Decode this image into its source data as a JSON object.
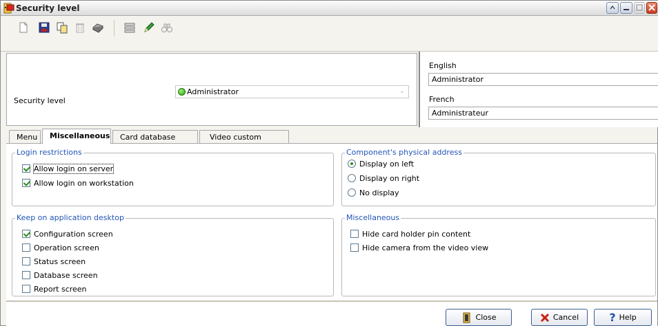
{
  "window": {
    "title": "Security level",
    "colors": {
      "title_gradient_top": "#fbfbfb",
      "close_button": "#c8381b",
      "accent_text": "#2155b5"
    }
  },
  "toolbar": {
    "icons": [
      "new-icon",
      "save-icon",
      "copy-icon",
      "delete-icon",
      "print-icon",
      "list-icon",
      "edit-pen-icon",
      "binoculars-icon"
    ]
  },
  "header": {
    "security_level_label": "Security level",
    "security_level_value": "Administrator",
    "status_color": "#2d9b10",
    "languages": [
      {
        "label": "English",
        "value": "Administrator"
      },
      {
        "label": "French",
        "value": "Administrateur"
      }
    ]
  },
  "tabs": [
    {
      "label": "Menu",
      "active": false
    },
    {
      "label": "Miscellaneous",
      "active": true
    },
    {
      "label": "Card database fields",
      "active": false
    },
    {
      "label": "Video custom button",
      "active": false
    }
  ],
  "groups": {
    "login": {
      "title": "Login restrictions",
      "items": [
        {
          "label": "Allow login on server",
          "checked": true
        },
        {
          "label": "Allow login on workstation",
          "checked": true
        }
      ]
    },
    "address": {
      "title": "Component's physical address",
      "options": [
        {
          "label": "Display on left",
          "selected": true
        },
        {
          "label": "Display on right",
          "selected": false
        },
        {
          "label": "No display",
          "selected": false
        }
      ]
    },
    "desktop": {
      "title": "Keep on application desktop",
      "items": [
        {
          "label": "Configuration screen",
          "checked": true
        },
        {
          "label": "Operation screen",
          "checked": false
        },
        {
          "label": "Status screen",
          "checked": false
        },
        {
          "label": "Database screen",
          "checked": false
        },
        {
          "label": "Report screen",
          "checked": false
        }
      ]
    },
    "misc": {
      "title": "Miscellaneous",
      "items": [
        {
          "label": "Hide card holder pin content",
          "checked": false
        },
        {
          "label": "Hide camera from the video view",
          "checked": false
        }
      ]
    }
  },
  "footer": {
    "close_label": "Close",
    "cancel_label": "Cancel",
    "help_label": "Help"
  }
}
